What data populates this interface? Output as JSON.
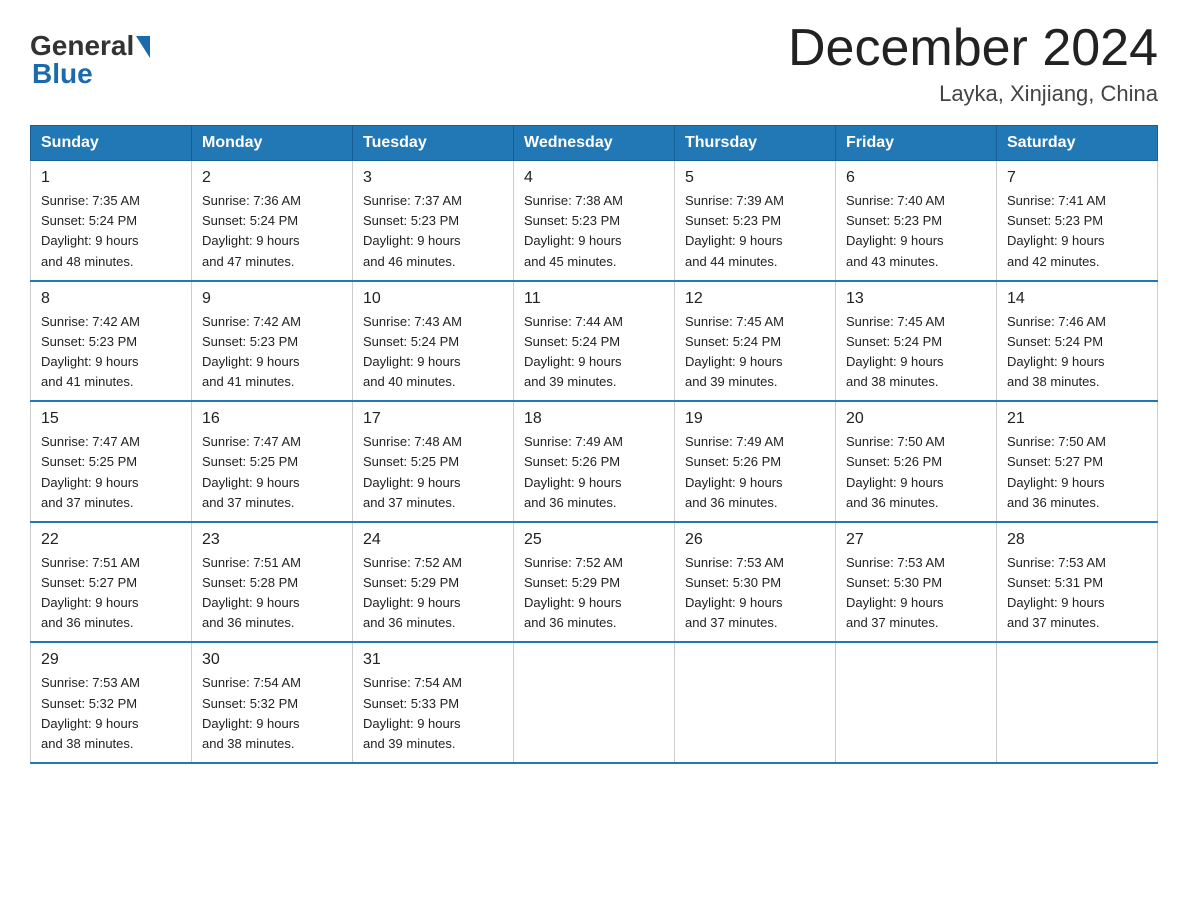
{
  "logo": {
    "text_general": "General",
    "text_blue": "Blue"
  },
  "title": "December 2024",
  "subtitle": "Layka, Xinjiang, China",
  "weekdays": [
    "Sunday",
    "Monday",
    "Tuesday",
    "Wednesday",
    "Thursday",
    "Friday",
    "Saturday"
  ],
  "weeks": [
    [
      {
        "day": "1",
        "sunrise": "7:35 AM",
        "sunset": "5:24 PM",
        "daylight": "9 hours and 48 minutes."
      },
      {
        "day": "2",
        "sunrise": "7:36 AM",
        "sunset": "5:24 PM",
        "daylight": "9 hours and 47 minutes."
      },
      {
        "day": "3",
        "sunrise": "7:37 AM",
        "sunset": "5:23 PM",
        "daylight": "9 hours and 46 minutes."
      },
      {
        "day": "4",
        "sunrise": "7:38 AM",
        "sunset": "5:23 PM",
        "daylight": "9 hours and 45 minutes."
      },
      {
        "day": "5",
        "sunrise": "7:39 AM",
        "sunset": "5:23 PM",
        "daylight": "9 hours and 44 minutes."
      },
      {
        "day": "6",
        "sunrise": "7:40 AM",
        "sunset": "5:23 PM",
        "daylight": "9 hours and 43 minutes."
      },
      {
        "day": "7",
        "sunrise": "7:41 AM",
        "sunset": "5:23 PM",
        "daylight": "9 hours and 42 minutes."
      }
    ],
    [
      {
        "day": "8",
        "sunrise": "7:42 AM",
        "sunset": "5:23 PM",
        "daylight": "9 hours and 41 minutes."
      },
      {
        "day": "9",
        "sunrise": "7:42 AM",
        "sunset": "5:23 PM",
        "daylight": "9 hours and 41 minutes."
      },
      {
        "day": "10",
        "sunrise": "7:43 AM",
        "sunset": "5:24 PM",
        "daylight": "9 hours and 40 minutes."
      },
      {
        "day": "11",
        "sunrise": "7:44 AM",
        "sunset": "5:24 PM",
        "daylight": "9 hours and 39 minutes."
      },
      {
        "day": "12",
        "sunrise": "7:45 AM",
        "sunset": "5:24 PM",
        "daylight": "9 hours and 39 minutes."
      },
      {
        "day": "13",
        "sunrise": "7:45 AM",
        "sunset": "5:24 PM",
        "daylight": "9 hours and 38 minutes."
      },
      {
        "day": "14",
        "sunrise": "7:46 AM",
        "sunset": "5:24 PM",
        "daylight": "9 hours and 38 minutes."
      }
    ],
    [
      {
        "day": "15",
        "sunrise": "7:47 AM",
        "sunset": "5:25 PM",
        "daylight": "9 hours and 37 minutes."
      },
      {
        "day": "16",
        "sunrise": "7:47 AM",
        "sunset": "5:25 PM",
        "daylight": "9 hours and 37 minutes."
      },
      {
        "day": "17",
        "sunrise": "7:48 AM",
        "sunset": "5:25 PM",
        "daylight": "9 hours and 37 minutes."
      },
      {
        "day": "18",
        "sunrise": "7:49 AM",
        "sunset": "5:26 PM",
        "daylight": "9 hours and 36 minutes."
      },
      {
        "day": "19",
        "sunrise": "7:49 AM",
        "sunset": "5:26 PM",
        "daylight": "9 hours and 36 minutes."
      },
      {
        "day": "20",
        "sunrise": "7:50 AM",
        "sunset": "5:26 PM",
        "daylight": "9 hours and 36 minutes."
      },
      {
        "day": "21",
        "sunrise": "7:50 AM",
        "sunset": "5:27 PM",
        "daylight": "9 hours and 36 minutes."
      }
    ],
    [
      {
        "day": "22",
        "sunrise": "7:51 AM",
        "sunset": "5:27 PM",
        "daylight": "9 hours and 36 minutes."
      },
      {
        "day": "23",
        "sunrise": "7:51 AM",
        "sunset": "5:28 PM",
        "daylight": "9 hours and 36 minutes."
      },
      {
        "day": "24",
        "sunrise": "7:52 AM",
        "sunset": "5:29 PM",
        "daylight": "9 hours and 36 minutes."
      },
      {
        "day": "25",
        "sunrise": "7:52 AM",
        "sunset": "5:29 PM",
        "daylight": "9 hours and 36 minutes."
      },
      {
        "day": "26",
        "sunrise": "7:53 AM",
        "sunset": "5:30 PM",
        "daylight": "9 hours and 37 minutes."
      },
      {
        "day": "27",
        "sunrise": "7:53 AM",
        "sunset": "5:30 PM",
        "daylight": "9 hours and 37 minutes."
      },
      {
        "day": "28",
        "sunrise": "7:53 AM",
        "sunset": "5:31 PM",
        "daylight": "9 hours and 37 minutes."
      }
    ],
    [
      {
        "day": "29",
        "sunrise": "7:53 AM",
        "sunset": "5:32 PM",
        "daylight": "9 hours and 38 minutes."
      },
      {
        "day": "30",
        "sunrise": "7:54 AM",
        "sunset": "5:32 PM",
        "daylight": "9 hours and 38 minutes."
      },
      {
        "day": "31",
        "sunrise": "7:54 AM",
        "sunset": "5:33 PM",
        "daylight": "9 hours and 39 minutes."
      },
      null,
      null,
      null,
      null
    ]
  ],
  "labels": {
    "sunrise": "Sunrise: ",
    "sunset": "Sunset: ",
    "daylight": "Daylight: "
  }
}
